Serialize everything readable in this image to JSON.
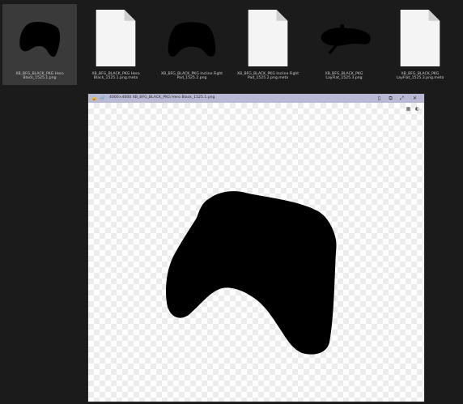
{
  "files": [
    {
      "name": "XB_BFG_BLACK_PKG Hero Black_1525.1.png",
      "kind": "image",
      "selected": true
    },
    {
      "name": "XB_BFG_BLACK_PKG Hero Black_1525.1.png.meta",
      "kind": "meta",
      "selected": false
    },
    {
      "name": "XB_BFG_BLACK_PKG Incline Fight Pad_1525.2.png",
      "kind": "image",
      "selected": false
    },
    {
      "name": "XB_BFG_BLACK_PKG Incline Fight Pad_1525.2.png.meta",
      "kind": "meta",
      "selected": false
    },
    {
      "name": "XB_BFG_BLACK_PKG LayFlat_1525.3.png",
      "kind": "image",
      "selected": false
    },
    {
      "name": "XB_BFG_BLACK_PKG LayFlat_1525.3.png.meta",
      "kind": "meta",
      "selected": false
    }
  ],
  "viewer": {
    "title": "4000×4000 XB_BFG_BLACK_PKG Hero Black_1525.1.png",
    "icons": {
      "left": [
        "lock-icon",
        "link-icon"
      ],
      "right": [
        "page-icon",
        "copy-icon",
        "expand-icon",
        "close-icon"
      ],
      "canvas": [
        "checker-toggle-icon",
        "color-channel-icon"
      ]
    }
  },
  "colors": {
    "background": "#1b1b1b",
    "selected_tile": "#3a3a3a",
    "titlebar": "#b9b9d6",
    "silhouette": "#000000"
  }
}
